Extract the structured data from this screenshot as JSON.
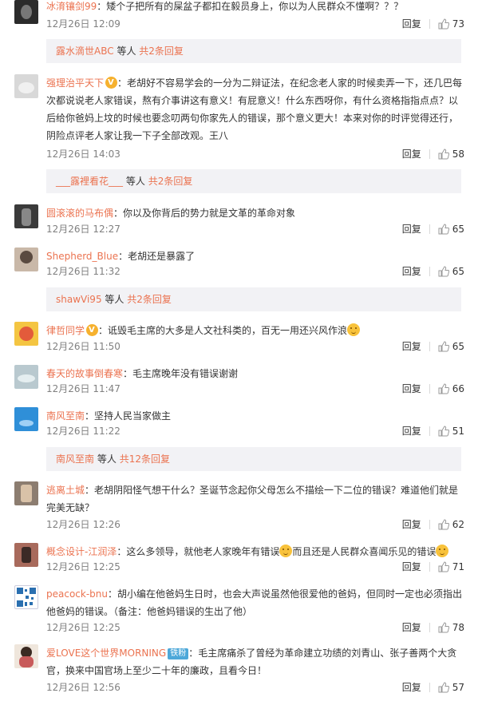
{
  "ui": {
    "reply_label": "回复",
    "etc_label": "等人"
  },
  "comments": [
    {
      "user": "冰淯镶剑99",
      "text": "：矮个子把所有的屎盆子都扣在毅员身上，你以为人民群众不懂啊？？？",
      "time": "12月26日 12:09",
      "likes": "73",
      "sub": {
        "user": "露水滴世ABC",
        "count": "共2条回复"
      }
    },
    {
      "user": "强理治平天下",
      "badge": "crown",
      "text": "：老胡好不容易学会的一分为二辩证法，在纪念老人家的时候卖弄一下，还几巴每次都说说老人家错误，熬有介事讲这有意义！有屁意义！什么东西呀你，有什么资格指指点点？以后给你爸妈上坟的时候也要念叨两句你家先人的错误，那个意义更大！本来对你的时评觉得还行，阴险点评老人家让我一下子全部改观。王八",
      "time": "12月26日 14:03",
      "likes": "58",
      "sub": {
        "user": "___露裡看花___",
        "count": "共2条回复"
      }
    },
    {
      "user": "圆滚滚的马布偶",
      "text": "：你以及你背后的势力就是文革的革命对象",
      "time": "12月26日 12:27",
      "likes": "65"
    },
    {
      "user": "Shepherd_Blue",
      "text": "：老胡还是暴露了",
      "time": "12月26日 11:32",
      "likes": "65",
      "sub": {
        "user": "shawVi95",
        "count": "共2条回复"
      }
    },
    {
      "user": "律哲同学",
      "badge": "crown",
      "text": "：诋毁毛主席的大多是人文社科类的，百无一用还兴风作浪",
      "emoji_end": true,
      "time": "12月26日 11:50",
      "likes": "65"
    },
    {
      "user": "春天的故事倒春寒",
      "text": "：毛主席晚年没有错误谢谢",
      "time": "12月26日 11:47",
      "likes": "66"
    },
    {
      "user": "南风至南",
      "text": "：坚持人民当家做主",
      "time": "12月26日 11:22",
      "likes": "51",
      "sub": {
        "user": "南风至南",
        "count": "共12条回复"
      }
    },
    {
      "user": "逃离土城",
      "text": "：老胡阴阳怪气想干什么？圣诞节念起你父母怎么不描绘一下二位的错误？难道他们就是完美无缺？",
      "time": "12月26日 12:26",
      "likes": "62"
    },
    {
      "user": "概念设计-江润泽",
      "text": "：这么多领导，就他老人家晚年有错误",
      "text2": "而且还是人民群众喜闻乐见的错误",
      "emoji_mid": true,
      "emoji_end": true,
      "time": "12月26日 12:25",
      "likes": "71"
    },
    {
      "user": "peacock-bnu",
      "text": "：胡小编在他爸妈生日时，也会大声说虽然他很爱他的爸妈，但同时一定也必须指出他爸妈的错误。（备注：他爸妈错误的生出了他）",
      "time": "12月26日 12:25",
      "likes": "78"
    },
    {
      "user": "爱LOVE这个世界MORNING",
      "badge": "tag",
      "badge_text": "铁粉",
      "text": "：毛主席痛杀了曾经为革命建立功绩的刘青山、张子善两个大贪官，换来中国官场上至少二十年的廉政，且看今日！",
      "time": "12月26日 12:56",
      "likes": "57"
    }
  ],
  "colors": {
    "username": "#eb7350",
    "meta": "#808080",
    "subbox_bg": "#f2f2f5"
  }
}
